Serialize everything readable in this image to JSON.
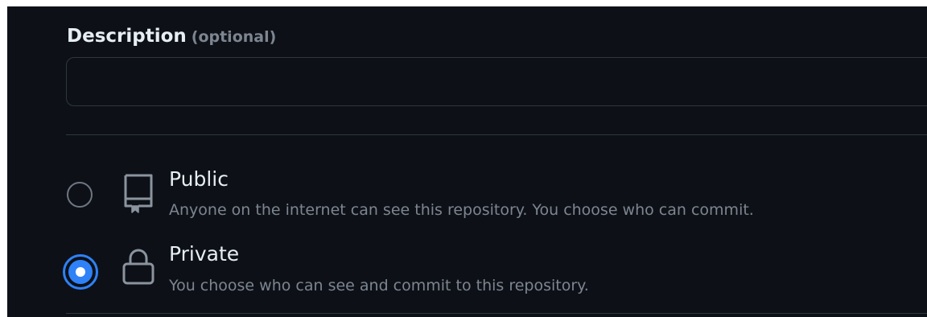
{
  "description": {
    "label": "Description",
    "optional_hint": "(optional)",
    "value": "",
    "placeholder": ""
  },
  "visibility": {
    "selected": "private",
    "options": [
      {
        "id": "public",
        "title": "Public",
        "description": "Anyone on the internet can see this repository. You choose who can commit.",
        "icon": "repo-book-icon",
        "checked": false
      },
      {
        "id": "private",
        "title": "Private",
        "description": "You choose who can see and commit to this repository.",
        "icon": "lock-icon",
        "checked": true
      }
    ]
  },
  "colors": {
    "background": "#0d1117",
    "text_primary": "#e6edf3",
    "text_muted": "#7d8590",
    "border": "#30363d",
    "accent": "#2f81f7"
  }
}
